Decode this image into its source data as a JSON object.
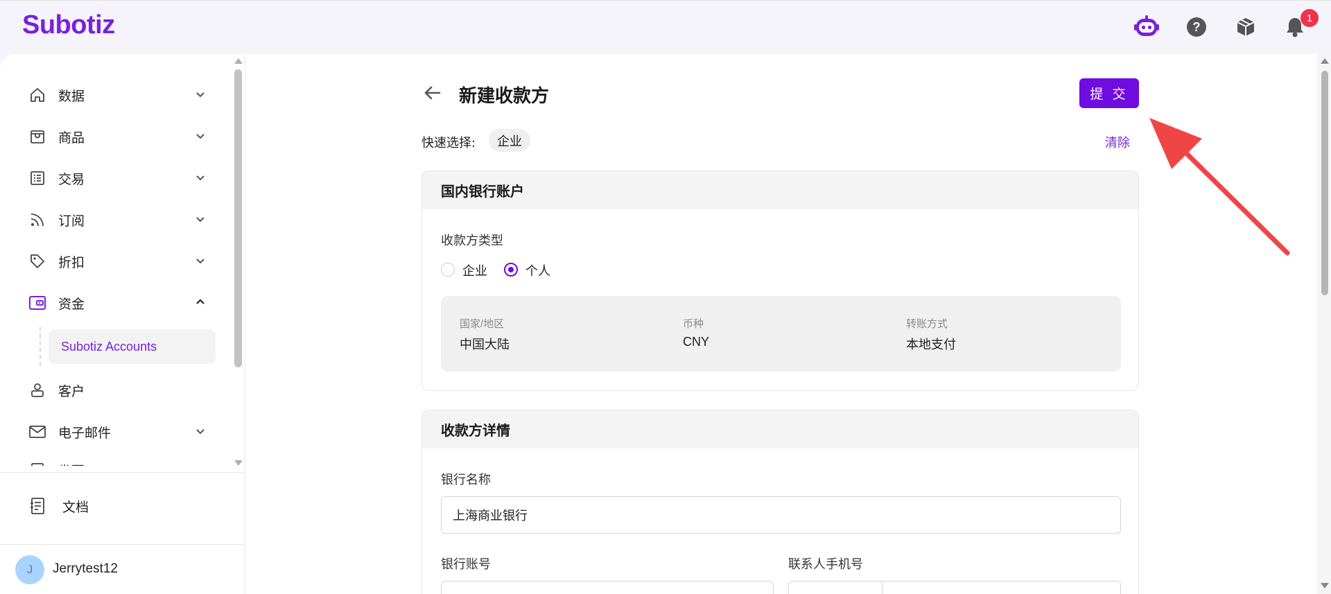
{
  "app": {
    "logo": "Subotiz"
  },
  "header": {
    "notification_count": "1",
    "icons": [
      "bot-assistant-icon",
      "help-icon",
      "package-icon",
      "bell-icon"
    ]
  },
  "sidebar": {
    "items": [
      {
        "label": "数据",
        "icon": "home-icon",
        "expanded": false
      },
      {
        "label": "商品",
        "icon": "store-icon",
        "expanded": false
      },
      {
        "label": "交易",
        "icon": "list-icon",
        "expanded": false
      },
      {
        "label": "订阅",
        "icon": "rss-icon",
        "expanded": false
      },
      {
        "label": "折扣",
        "icon": "tag-icon",
        "expanded": false
      },
      {
        "label": "资金",
        "icon": "wallet-icon",
        "expanded": true
      },
      {
        "label": "客户",
        "icon": "customer-icon"
      },
      {
        "label": "电子邮件",
        "icon": "mail-icon",
        "expanded": false
      },
      {
        "label": "发票",
        "icon": "invoice-icon",
        "expanded": false
      }
    ],
    "active_sub_item": "Subotiz Accounts",
    "docs_label": "文档",
    "user": {
      "initial": "J",
      "name": "Jerrytest12"
    }
  },
  "page": {
    "title": "新建收款方",
    "submit_label": "提 交",
    "quick_select_label": "快速选择:",
    "quick_select_chip": "企业",
    "clear_label": "清除"
  },
  "bank_account_card": {
    "title": "国内银行账户",
    "payee_type_label": "收款方类型",
    "options": [
      "企业",
      "个人"
    ],
    "selected_option": "个人",
    "info": {
      "country_caption": "国家/地区",
      "country_value": "中国大陆",
      "currency_caption": "币种",
      "currency_value": "CNY",
      "transfer_caption": "转账方式",
      "transfer_value": "本地支付"
    }
  },
  "payee_details_card": {
    "title": "收款方详情",
    "bank_name_label": "银行名称",
    "bank_name_value": "上海商业银行",
    "account_number_label": "银行账号",
    "contact_phone_label": "联系人手机号"
  },
  "colors": {
    "brand": "#7a1fe0",
    "primary_button": "#6f0ce0",
    "badge": "#f0334b",
    "annotation_arrow": "#f04545"
  }
}
